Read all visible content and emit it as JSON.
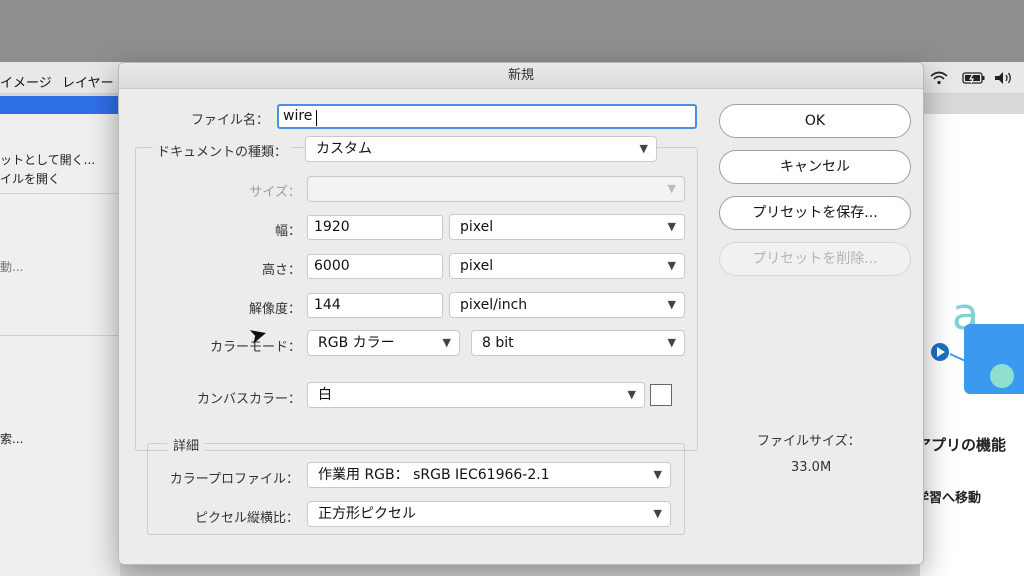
{
  "background": {
    "menu": [
      "イメージ",
      "レイヤー"
    ],
    "left_items": [
      "ットとして開く...",
      "イルを開く",
      "動...",
      "索..."
    ],
    "right_texts": [
      "アプリの機能",
      "学習へ移動"
    ],
    "status_icons": [
      "wifi-icon",
      "battery-icon",
      "volume-icon"
    ]
  },
  "dialog": {
    "title": "新規",
    "filename_label": "ファイル名：",
    "filename_value": "wire",
    "doc_type_label": "ドキュメントの種類：",
    "doc_type_value": "カスタム",
    "size_label": "サイズ：",
    "size_value": "",
    "width_label": "幅：",
    "width_value": "1920",
    "width_unit": "pixel",
    "height_label": "高さ：",
    "height_value": "6000",
    "height_unit": "pixel",
    "resolution_label": "解像度：",
    "resolution_value": "144",
    "resolution_unit": "pixel/inch",
    "color_mode_label": "カラーモード：",
    "color_mode_value": "RGB カラー",
    "bit_depth_value": "8 bit",
    "canvas_color_label": "カンバスカラー：",
    "canvas_color_value": "白",
    "details_label": "詳細",
    "color_profile_label": "カラープロファイル：",
    "color_profile_value": "作業用 RGB： sRGB IEC61966-2.1",
    "pixel_aspect_label": "ピクセル縦横比：",
    "pixel_aspect_value": "正方形ピクセル",
    "buttons": {
      "ok": "OK",
      "cancel": "キャンセル",
      "save_preset": "プリセットを保存...",
      "delete_preset": "プリセットを削除..."
    },
    "file_size_label": "ファイルサイズ：",
    "file_size_value": "33.0M"
  }
}
